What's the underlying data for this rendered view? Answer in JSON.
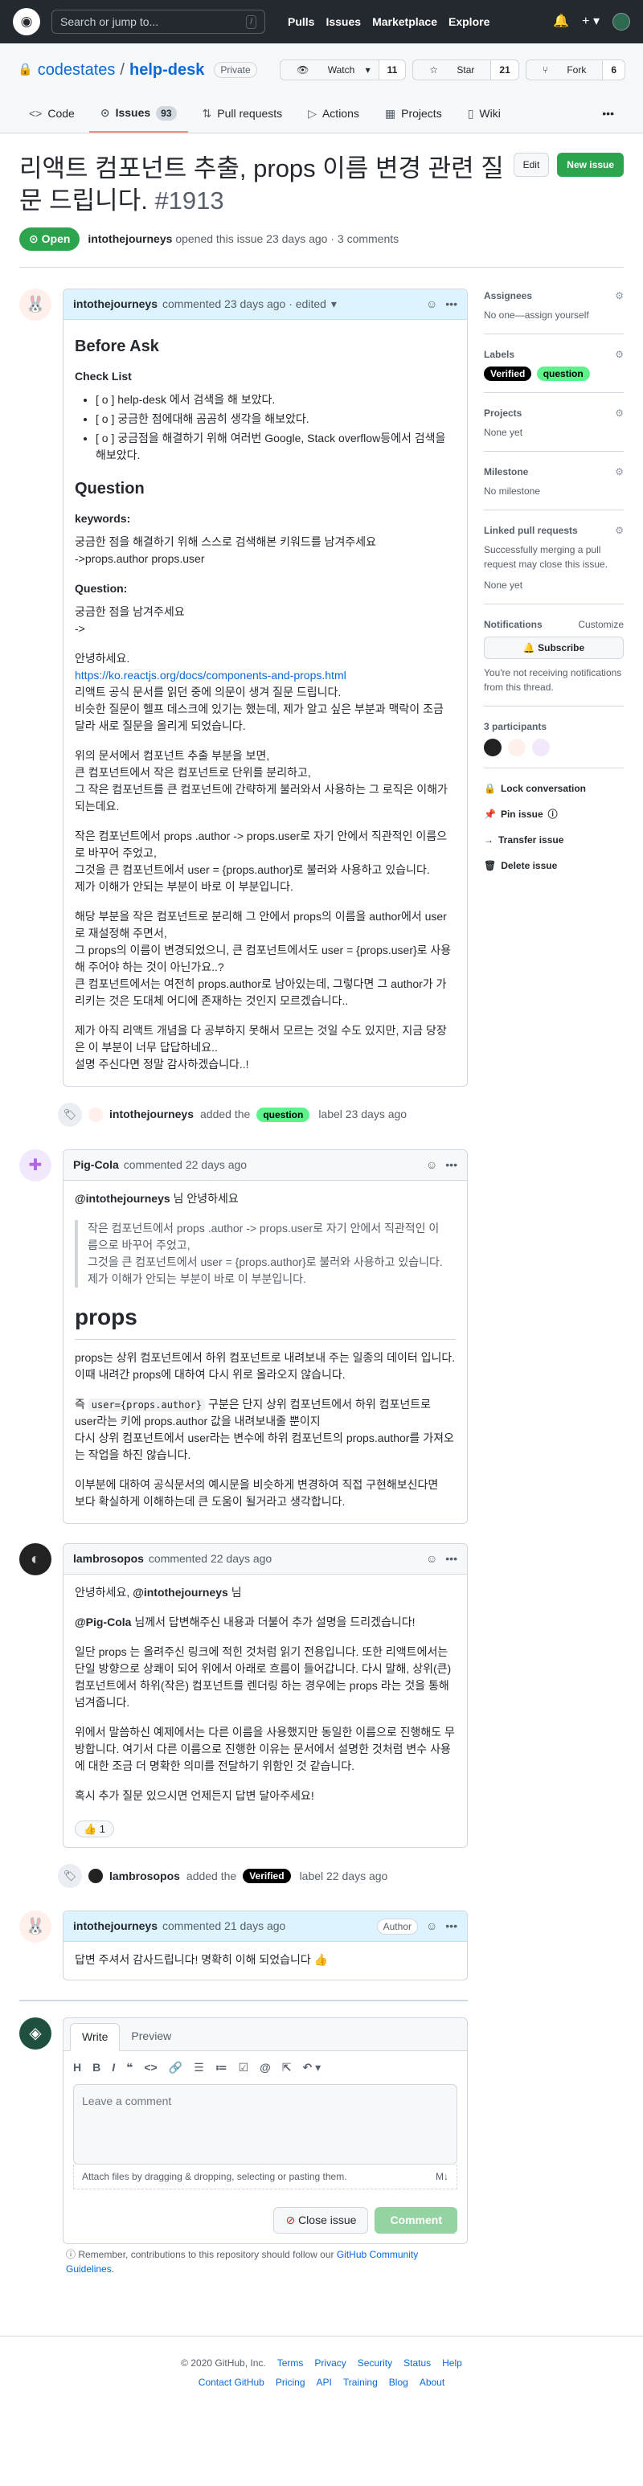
{
  "header": {
    "search_placeholder": "Search or jump to...",
    "slash": "/",
    "nav": [
      "Pulls",
      "Issues",
      "Marketplace",
      "Explore"
    ]
  },
  "repo": {
    "owner": "codestates",
    "name": "help-desk",
    "visibility": "Private",
    "watch_label": "Watch",
    "watch_count": "11",
    "star_label": "Star",
    "star_count": "21",
    "fork_label": "Fork",
    "fork_count": "6",
    "tabs": [
      {
        "label": "Code"
      },
      {
        "label": "Issues",
        "count": "93"
      },
      {
        "label": "Pull requests"
      },
      {
        "label": "Actions"
      },
      {
        "label": "Projects"
      },
      {
        "label": "Wiki"
      }
    ]
  },
  "issue": {
    "title": "리액트 컴포넌트 추출, props 이름 변경 관련 질문 드립니다.",
    "number": "#1913",
    "edit_label": "Edit",
    "new_issue_label": "New issue",
    "state": "Open",
    "author": "intothejourneys",
    "opened_text": "opened this issue 23 days ago · 3 comments"
  },
  "comments": [
    {
      "author": "intothejourneys",
      "meta": "commented 23 days ago · edited",
      "h_before": "Before Ask",
      "h_check": "Check List",
      "checklist": [
        "[ o ] help-desk 에서 검색을 해 보았다.",
        "[ o ] 궁금한 점에대해 곰곰히 생각을 해보았다.",
        "[ o ] 궁금점을 해결하기 위해 여러번 Google, Stack overflow등에서 검색을 해보았다."
      ],
      "h_question": "Question",
      "h_keywords": "keywords:",
      "keywords_text": "궁금한 점을 해결하기 위해 스스로 검색해본 키워드를 남겨주세요\n->props.author props.user",
      "h_question2": "Question:",
      "question_text": "궁금한 점을 남겨주세요\n->",
      "greeting": "안녕하세요.",
      "link": "https://ko.reactjs.org/docs/components-and-props.html",
      "p1": "리액트 공식 문서를 읽던 중에 의문이 생겨 질문 드립니다.\n비슷한 질문이 헬프 데스크에 있기는 했는데, 제가 알고 싶은 부분과 맥락이 조금 달라 새로 질문을 올리게 되었습니다.",
      "p2": "위의 문서에서 컴포넌트 추출 부분을 보면,\n큰 컴포넌트에서 작은 컴포넌트로 단위를 분리하고,\n그 작은 컴포넌트를 큰 컴포넌트에 간략하게 불러와서 사용하는 그 로직은 이해가 되는데요.",
      "p3": "작은 컴포넌트에서 props .author -> props.user로 자기 안에서 직관적인 이름으로 바꾸어 주었고,\n그것을 큰 컴포넌트에서 user = {props.author}로 불러와 사용하고 있습니다.\n제가 이해가 안되는 부분이 바로 이 부분입니다.",
      "p4": "해당 부분을 작은 컴포넌트로 분리해 그 안에서 props의 이름을 author에서 user로 재설정해 주면서,\n그 props의 이름이 변경되었으니, 큰 컴포넌트에서도 user = {props.user}로 사용해 주어야 하는 것이 아닌가요..?\n큰 컴포넌트에서는 여전히 props.author로 남아있는데, 그렇다면 그 author가 가리키는 것은 도대체 어디에 존재하는 것인지 모르겠습니다..",
      "p5": "제가 아직 리액트 개념을 다 공부하지 못해서 모르는 것일 수도 있지만, 지금 당장은 이 부분이 너무 답답하네요..\n설명 주신다면 정말 감사하겠습니다..!"
    },
    {
      "author": "Pig-Cola",
      "meta": "commented 22 days ago",
      "greeting_mention": "@intothejourneys",
      "greeting_rest": " 님 안녕하세요",
      "quote": "작은 컴포넌트에서 props .author -> props.user로 자기 안에서 직관적인 이름으로 바꾸어 주었고,\n그것을 큰 컴포넌트에서 user = {props.author}로 불러와 사용하고 있습니다.\n제가 이해가 안되는 부분이 바로 이 부분입니다.",
      "heading": "props",
      "p1": "props는 상위 컴포넌트에서 하위 컴포넌트로 내려보내 주는 일종의 데이터 입니다.\n이때 내려간 props에 대하여 다시 위로 올라오지 않습니다.",
      "p2_pre": "즉 ",
      "p2_code": "user={props.author}",
      "p2_post": " 구분은 단지 상위 컴포넌트에서 하위 컴포넌트로 user라는 키에 props.author 값을 내려보내줄 뿐이지\n다시 상위 컴포넌트에서 user라는 변수에 하위 컴포넌트의 props.author를 가져오는 작업을 하진 않습니다.",
      "p3": "이부분에 대하여 공식문서의 예시문을 비슷하게 변경하여 직접 구현해보신다면\n보다 확실하게 이해하는데 큰 도움이 될거라고 생각합니다."
    },
    {
      "author": "lambrosopos",
      "meta": "commented 22 days ago",
      "p1_pre": "안녕하세요, ",
      "p1_mention": "@intothejourneys",
      "p1_post": " 님",
      "p2_mention": "@Pig-Cola",
      "p2_post": " 님께서 답변해주신 내용과 더불어 추가 설명을 드리겠습니다!",
      "p3": "일단 props 는 올려주신 링크에 적힌 것처럼 읽기 전용입니다. 또한 리액트에서는 단일 방향으로 상쾌이 되어 위에서 아래로 흐름이 들어갑니다. 다시 말해, 상위(큰) 컴포넌트에서 하위(작은) 컴포넌트를 렌더링 하는 경우에는 props 라는 것을 통해 넘겨줍니다.",
      "p4": "위에서 말씀하신 예제에서는 다른 이름을 사용했지만 동일한 이름으로 진행해도 무방합니다. 여기서 다른 이름으로 진행한 이유는 문서에서 설명한 것처럼 변수 사용에 대한 조금 더 명확한 의미를 전달하기 위함인 것 같습니다.",
      "p5": "혹시 추가 질문 있으시면 언제든지 답변 달아주세요!",
      "reaction": "👍 1"
    },
    {
      "author": "intothejourneys",
      "meta": "commented 21 days ago",
      "badge": "Author",
      "p1": "답변 주셔서 감사드립니다! 명확히 이해 되었습니다 👍"
    }
  ],
  "events": [
    {
      "actor": "intothejourneys",
      "pre": "added the",
      "label": "question",
      "post": "label 23 days ago"
    },
    {
      "actor": "lambrosopos",
      "pre": "added the",
      "label": "Verified",
      "post": "label 22 days ago"
    }
  ],
  "sidebar": {
    "assignees_h": "Assignees",
    "assignees_v": "No one—assign yourself",
    "labels_h": "Labels",
    "labels": [
      "Verified",
      "question"
    ],
    "projects_h": "Projects",
    "projects_v": "None yet",
    "milestone_h": "Milestone",
    "milestone_v": "No milestone",
    "linked_h": "Linked pull requests",
    "linked_desc": "Successfully merging a pull request may close this issue.",
    "linked_v": "None yet",
    "notifications_h": "Notifications",
    "customize": "Customize",
    "subscribe": "Subscribe",
    "notif_desc": "You're not receiving notifications from this thread.",
    "participants_h": "3 participants",
    "actions": [
      "Lock conversation",
      "Pin issue",
      "Transfer issue",
      "Delete issue"
    ]
  },
  "composer": {
    "tab_write": "Write",
    "tab_preview": "Preview",
    "placeholder": "Leave a comment",
    "attach": "Attach files by dragging & dropping, selecting or pasting them.",
    "close_label": "Close issue",
    "comment_label": "Comment",
    "remember_pre": "Remember, contributions to this repository should follow our ",
    "remember_link": "GitHub Community Guidelines",
    "remember_post": "."
  },
  "footer": {
    "row1": [
      "© 2020 GitHub, Inc.",
      "Terms",
      "Privacy",
      "Security",
      "Status",
      "Help"
    ],
    "row2": [
      "Contact GitHub",
      "Pricing",
      "API",
      "Training",
      "Blog",
      "About"
    ]
  }
}
